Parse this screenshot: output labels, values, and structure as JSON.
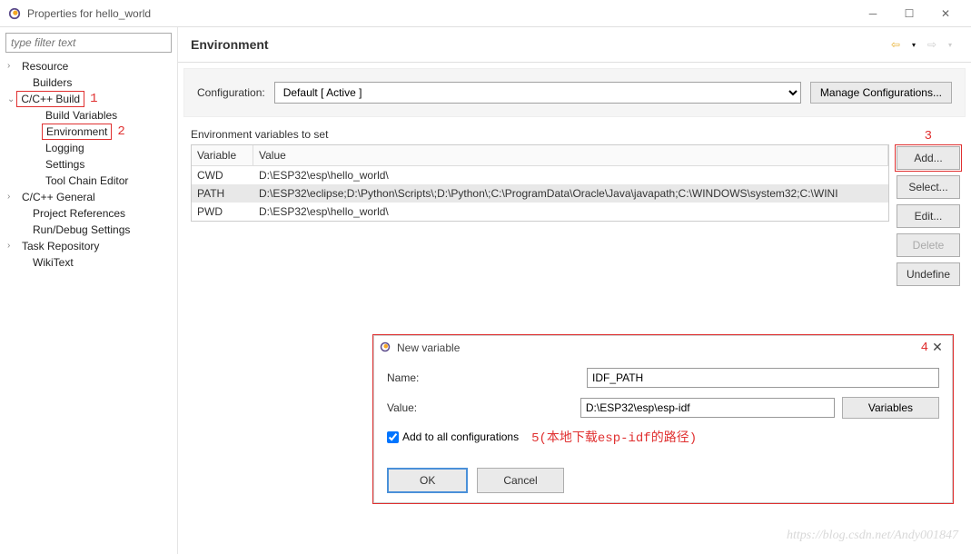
{
  "titlebar": {
    "title": "Properties for hello_world"
  },
  "sidebar": {
    "filter_placeholder": "type filter text",
    "items": [
      {
        "label": "Resource",
        "chev": ">"
      },
      {
        "label": "Builders"
      },
      {
        "label": "C/C++ Build",
        "chev": "v",
        "boxed": true,
        "ann": "1"
      },
      {
        "label": "Build Variables",
        "level": 2
      },
      {
        "label": "Environment",
        "level": 2,
        "boxed": true,
        "ann": "2"
      },
      {
        "label": "Logging",
        "level": 2
      },
      {
        "label": "Settings",
        "level": 2
      },
      {
        "label": "Tool Chain Editor",
        "level": 2
      },
      {
        "label": "C/C++ General",
        "chev": ">"
      },
      {
        "label": "Project References"
      },
      {
        "label": "Run/Debug Settings"
      },
      {
        "label": "Task Repository",
        "chev": ">"
      },
      {
        "label": "WikiText"
      }
    ]
  },
  "header": {
    "title": "Environment"
  },
  "config": {
    "label": "Configuration:",
    "value": "Default   [ Active ]",
    "manage_label": "Manage Configurations..."
  },
  "env": {
    "section_label": "Environment variables to set",
    "columns": {
      "var": "Variable",
      "val": "Value"
    },
    "rows": [
      {
        "var": "CWD",
        "val": "D:\\ESP32\\esp\\hello_world\\"
      },
      {
        "var": "PATH",
        "val": "D:\\ESP32\\eclipse;D:\\Python\\Scripts\\;D:\\Python\\;C:\\ProgramData\\Oracle\\Java\\javapath;C:\\WINDOWS\\system32;C:\\WINI",
        "selected": true
      },
      {
        "var": "PWD",
        "val": "D:\\ESP32\\esp\\hello_world\\"
      }
    ],
    "buttons": {
      "add": "Add...",
      "select": "Select...",
      "edit": "Edit...",
      "delete": "Delete",
      "undefine": "Undefine"
    },
    "ann3": "3"
  },
  "dialog": {
    "title": "New variable",
    "ann4": "4",
    "name_label": "Name:",
    "name_value": "IDF_PATH",
    "value_label": "Value:",
    "value_value": "D:\\ESP32\\esp\\esp-idf",
    "variables_btn": "Variables",
    "checkbox_label": "Add to all configurations",
    "ann5": "5(本地下载esp-idf的路径)",
    "ok": "OK",
    "cancel": "Cancel"
  },
  "watermark": "https://blog.csdn.net/Andy001847"
}
